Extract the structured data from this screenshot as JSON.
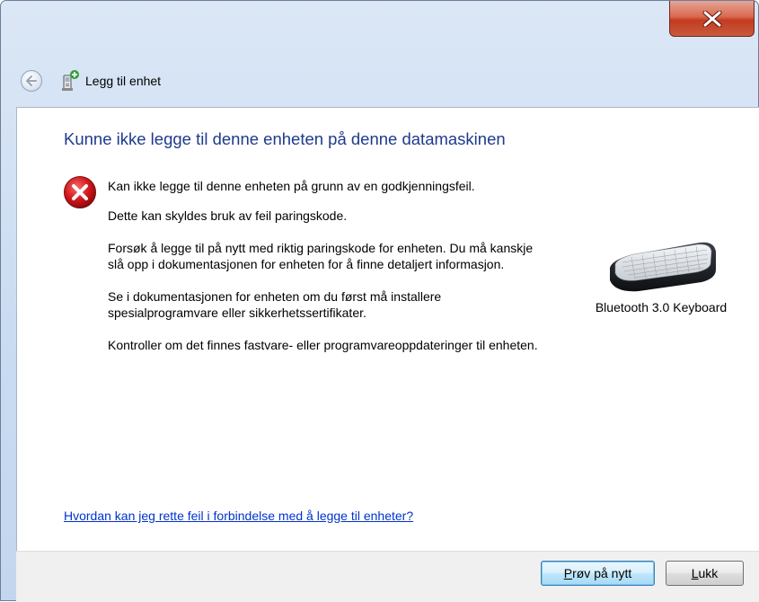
{
  "window": {
    "close_icon": "close-x-icon"
  },
  "nav": {
    "back_icon": "back-arrow-icon",
    "title_icon": "add-device-icon",
    "title": "Legg til enhet"
  },
  "main": {
    "heading": "Kunne ikke legge til denne enheten på denne datamaskinen",
    "error_icon": "error-icon",
    "messages": [
      "Kan ikke legge til denne enheten på grunn av en godkjenningsfeil.",
      "Dette kan skyldes bruk av feil paringskode.",
      "Forsøk å legge til på nytt med riktig paringskode for enheten. Du må kanskje slå opp i dokumentasjonen for enheten for å finne detaljert informasjon.",
      "Se i dokumentasjonen for enheten om du først må installere spesialprogramvare eller sikkerhetssertifikater.",
      "Kontroller om det finnes fastvare- eller programvareoppdateringer til enheten."
    ],
    "device": {
      "icon": "keyboard-icon",
      "name": "Bluetooth 3.0 Keyboard"
    },
    "help_link": "Hvordan kan jeg rette feil i forbindelse med å legge til enheter?"
  },
  "footer": {
    "retry_label": "Prøv på nytt",
    "retry_accel": "P",
    "retry_rest": "røv på nytt",
    "close_label": "Lukk",
    "close_accel": "L",
    "close_rest": "ukk"
  },
  "colors": {
    "heading": "#1e3a8c",
    "link": "#0033cc",
    "close_button": "#c43b20",
    "error_red": "#c4161c"
  }
}
